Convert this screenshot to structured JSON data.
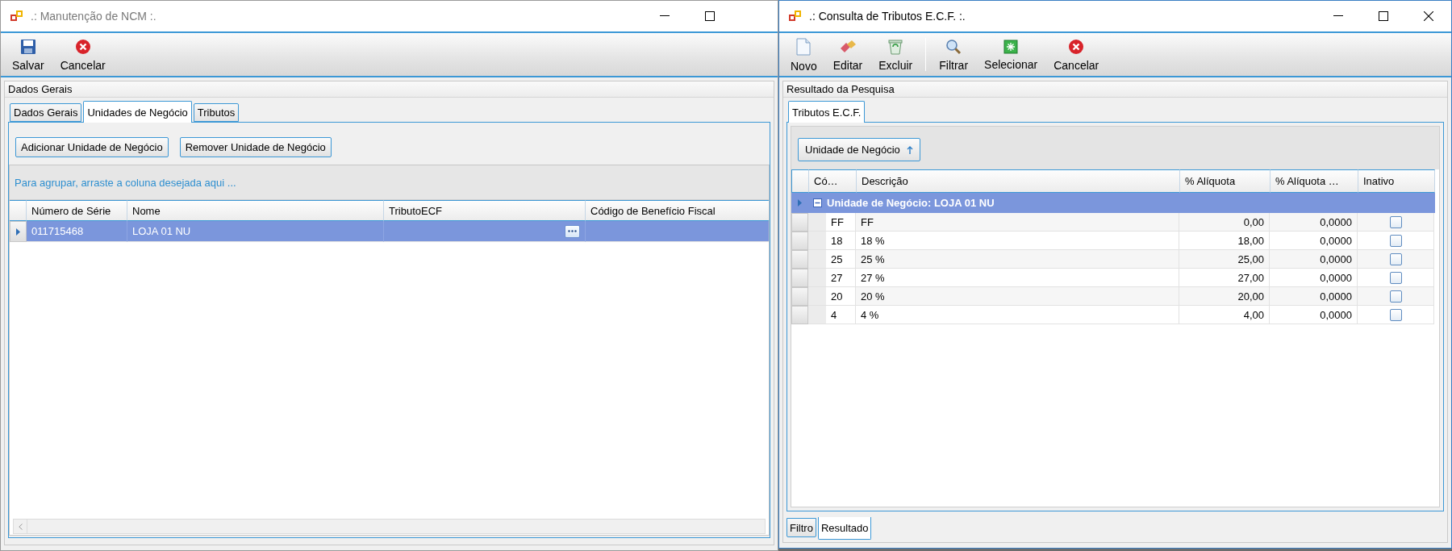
{
  "left_window": {
    "title": ".: Manutenção de NCM :.",
    "toolbar": [
      "Salvar",
      "Cancelar"
    ],
    "panel_title": "Dados Gerais",
    "tabs": [
      {
        "label": "Dados Gerais",
        "selected": false
      },
      {
        "label": "Unidades de Negócio",
        "selected": true
      },
      {
        "label": "Tributos",
        "selected": false
      }
    ],
    "buttons": [
      "Adicionar Unidade de Negócio",
      "Remover Unidade de Negócio"
    ],
    "group_hint": "Para agrupar, arraste a coluna desejada aqui ...",
    "grid": {
      "columns": [
        "Número de Série",
        "Nome",
        "TributoECF",
        "Código de Benefício Fiscal"
      ],
      "rows": [
        {
          "serial": "011715468",
          "name": "LOJA 01 NU",
          "selected": true
        }
      ]
    }
  },
  "right_window": {
    "title": ".: Consulta de Tributos E.C.F. :.",
    "toolbar_groups": [
      [
        "Novo",
        "Editar",
        "Excluir"
      ],
      [
        "Filtrar",
        "Selecionar",
        "Cancelar"
      ]
    ],
    "panel_title": "Resultado da Pesquisa",
    "tabs": [
      {
        "label": "Tributos E.C.F.",
        "selected": true
      }
    ],
    "group_by_button": "Unidade de Negócio",
    "grid": {
      "columns": [
        "Có…",
        "Descrição",
        "% Alíquota",
        "% Alíquota …",
        "Inativo"
      ],
      "group": {
        "label": "Unidade de Negócio: LOJA 01 NU",
        "expanded": true,
        "selected": true
      },
      "rows": [
        {
          "code": "FF",
          "description": "FF",
          "rate": "0,00",
          "rate_2": "0,0000",
          "inactive": false,
          "selected": false
        },
        {
          "code": "18",
          "description": "18 %",
          "rate": "18,00",
          "rate_2": "0,0000",
          "inactive": false,
          "selected": false
        },
        {
          "code": "25",
          "description": "25 %",
          "rate": "25,00",
          "rate_2": "0,0000",
          "inactive": false,
          "selected": false
        },
        {
          "code": "27",
          "description": "27 %",
          "rate": "27,00",
          "rate_2": "0,0000",
          "inactive": false,
          "selected": false
        },
        {
          "code": "20",
          "description": "20 %",
          "rate": "20,00",
          "rate_2": "0,0000",
          "inactive": false,
          "selected": false
        },
        {
          "code": "4",
          "description": "4 %",
          "rate": "4,00",
          "rate_2": "0,0000",
          "inactive": false,
          "selected": false
        }
      ]
    },
    "bottom_tabs": [
      {
        "label": "Filtro",
        "selected": false
      },
      {
        "label": "Resultado",
        "selected": true
      }
    ]
  }
}
